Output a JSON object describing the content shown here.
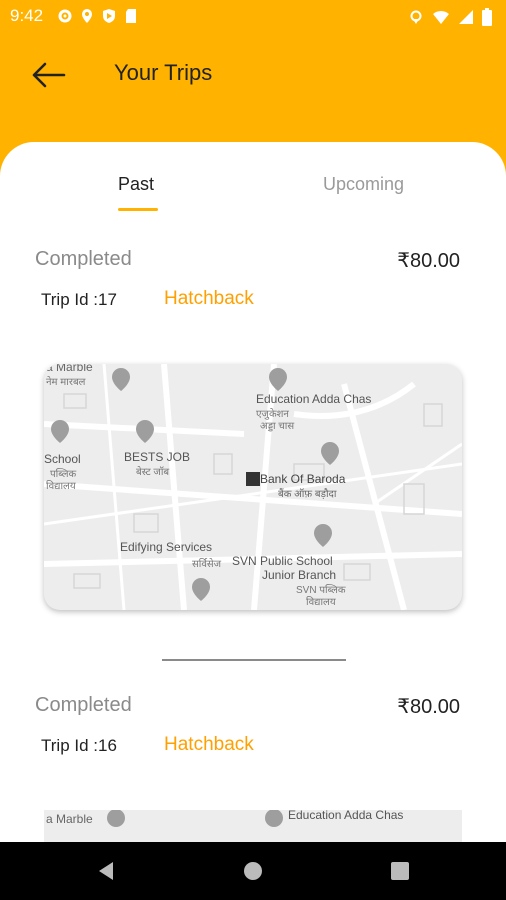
{
  "status_bar": {
    "time": "9:42"
  },
  "header": {
    "title": "Your Trips"
  },
  "tabs": [
    {
      "label": "Past",
      "active": true
    },
    {
      "label": "Upcoming",
      "active": false
    }
  ],
  "trips": [
    {
      "status": "Completed",
      "price": "₹80.00",
      "trip_id": "Trip Id :17",
      "vehicle": "Hatchback",
      "map_labels": {
        "marble": "a Marble",
        "marble_hi": "नेम मारबल",
        "education": "Education Adda Chas",
        "education_hi": "एजुकेशन",
        "education_hi2": "अड्डा चास",
        "school": "School",
        "school_hi": "पब्लिक",
        "school_hi2": "विद्यालय",
        "bests_job": "BESTS JOB",
        "bests_job_hi": "बेस्ट जॉब",
        "bank": "Bank Of Baroda",
        "bank_hi": "बैंक ऑफ़ बड़ौदा",
        "edifying": "Edifying Services",
        "edifying_hi": "सर्विसेज",
        "svn": "SVN Public School",
        "svn2": "Junior Branch",
        "svn_hi": "SVN पब्लिक",
        "svn_hi2": "विद्यालय"
      }
    },
    {
      "status": "Completed",
      "price": "₹80.00",
      "trip_id": "Trip Id :16",
      "vehicle": "Hatchback",
      "map_labels": {
        "marble": "a Marble",
        "education": "Education Adda Chas"
      }
    }
  ],
  "colors": {
    "accent": "#FFB300",
    "vehicle": "#FFA000"
  }
}
